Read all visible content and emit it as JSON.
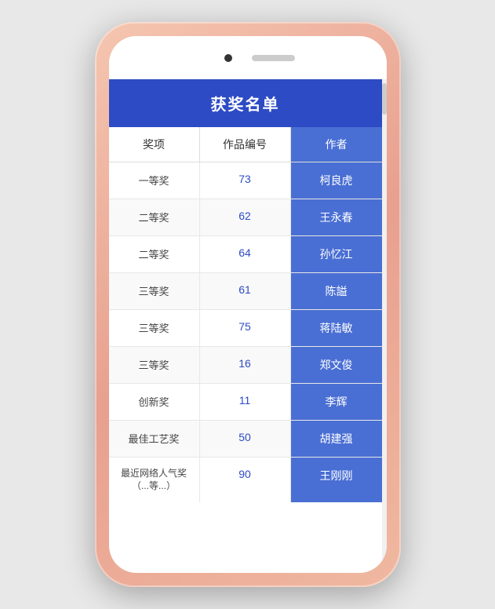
{
  "phone": {
    "title": "获奖名单"
  },
  "table": {
    "headers": [
      "奖项",
      "作品编号",
      "作者"
    ],
    "rows": [
      {
        "award": "一等奖",
        "number": "73",
        "author": "柯良虎"
      },
      {
        "award": "二等奖",
        "number": "62",
        "author": "王永春"
      },
      {
        "award": "二等奖",
        "number": "64",
        "author": "孙忆江"
      },
      {
        "award": "三等奖",
        "number": "61",
        "author": "陈謚"
      },
      {
        "award": "三等奖",
        "number": "75",
        "author": "蒋陆敏"
      },
      {
        "award": "三等奖",
        "number": "16",
        "author": "郑文俊"
      },
      {
        "award": "创新奖",
        "number": "11",
        "author": "李辉"
      },
      {
        "award": "最佳工艺奖",
        "number": "50",
        "author": "胡建强"
      },
      {
        "award": "最近网络人气奖\n（...等...）",
        "number": "90",
        "author": "王刚刚"
      }
    ]
  },
  "colors": {
    "header_bg": "#2d4bc4",
    "author_cell_bg": "#4a6fd4",
    "accent": "#2d4bc4"
  }
}
